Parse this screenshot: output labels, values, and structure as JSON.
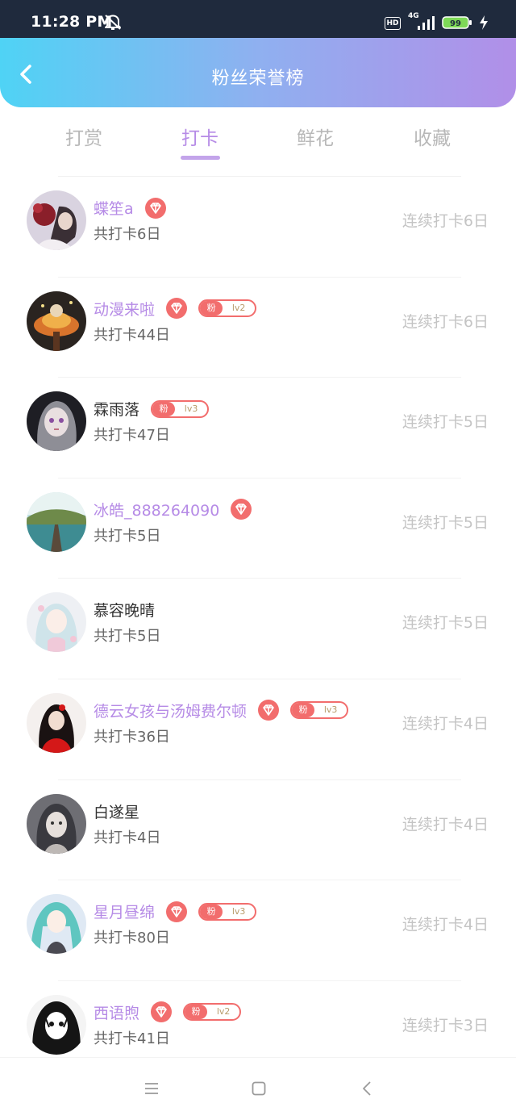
{
  "status_bar": {
    "time": "11:28 PM",
    "hd_label": "HD",
    "network_label": "4G",
    "battery_level": "99",
    "icons": [
      "bell-off-icon",
      "signal-icon",
      "battery-icon",
      "charging-icon"
    ]
  },
  "header": {
    "title": "粉丝荣誉榜",
    "back_icon": "chevron-left-icon"
  },
  "tabs": [
    {
      "label": "打赏",
      "active": false
    },
    {
      "label": "打卡",
      "active": true
    },
    {
      "label": "鲜花",
      "active": false
    },
    {
      "label": "收藏",
      "active": false
    }
  ],
  "colors": {
    "accent": "#b68be6",
    "header_gradient_start": "#4fd3f5",
    "header_gradient_end": "#b18fe8",
    "badge_red": "#f26d6d",
    "muted": "#c4c4c4"
  },
  "fans": [
    {
      "name": "蝶笙a",
      "vip": true,
      "fan_badge": null,
      "total": "共打卡6日",
      "streak": "连续打卡6日"
    },
    {
      "name": "动漫来啦",
      "vip": true,
      "fan_badge": {
        "tag": "粉",
        "level": "lv2"
      },
      "total": "共打卡44日",
      "streak": "连续打卡6日"
    },
    {
      "name": "霖雨落",
      "vip": false,
      "fan_badge": {
        "tag": "粉",
        "level": "lv3"
      },
      "total": "共打卡47日",
      "streak": "连续打卡5日"
    },
    {
      "name": "冰皓_888264090",
      "vip": true,
      "fan_badge": null,
      "total": "共打卡5日",
      "streak": "连续打卡5日"
    },
    {
      "name": "慕容晚晴",
      "vip": false,
      "fan_badge": null,
      "total": "共打卡5日",
      "streak": "连续打卡5日"
    },
    {
      "name": "德云女孩与汤姆费尔顿",
      "vip": true,
      "fan_badge": {
        "tag": "粉",
        "level": "lv3"
      },
      "total": "共打卡36日",
      "streak": "连续打卡4日"
    },
    {
      "name": "白遂星",
      "vip": false,
      "fan_badge": null,
      "total": "共打卡4日",
      "streak": "连续打卡4日"
    },
    {
      "name": "星月昼绵",
      "vip": true,
      "fan_badge": {
        "tag": "粉",
        "level": "lv3"
      },
      "total": "共打卡80日",
      "streak": "连续打卡4日"
    },
    {
      "name": "西语煦",
      "vip": true,
      "fan_badge": {
        "tag": "粉",
        "level": "lv2"
      },
      "total": "共打卡41日",
      "streak": "连续打卡3日"
    }
  ],
  "nav_bar": {
    "icons": [
      "menu-icon",
      "home-square-icon",
      "back-triangle-icon"
    ]
  }
}
